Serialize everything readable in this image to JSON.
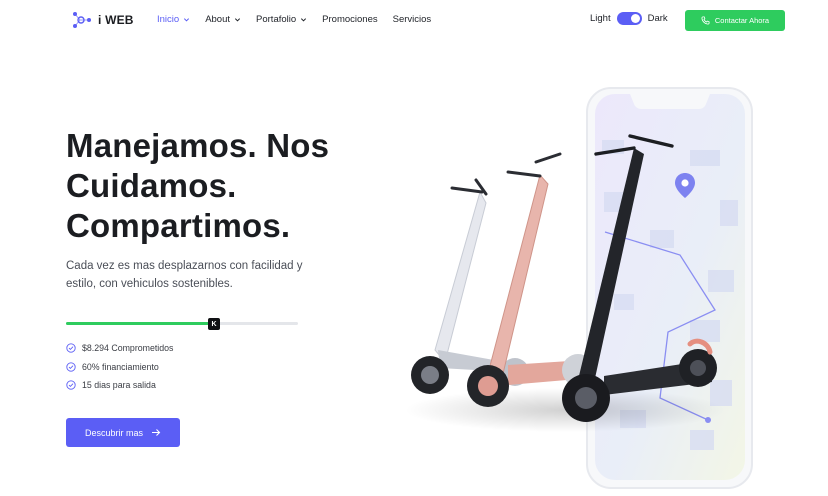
{
  "brand": {
    "name": "i WEB"
  },
  "nav": {
    "items": [
      {
        "label": "Inicio",
        "dropdown": true,
        "active": true
      },
      {
        "label": "About",
        "dropdown": true,
        "active": false
      },
      {
        "label": "Portafolio",
        "dropdown": true,
        "active": false
      },
      {
        "label": "Promociones",
        "dropdown": false,
        "active": false
      },
      {
        "label": "Servicios",
        "dropdown": false,
        "active": false
      }
    ],
    "theme": {
      "light_label": "Light",
      "dark_label": "Dark",
      "dark_enabled": true
    },
    "cta_label": "Contactar Ahora"
  },
  "hero": {
    "headline": [
      "Manejamos. Nos",
      "Cuidamos.",
      "Compartimos."
    ],
    "subtitle": "Cada vez es mas desplazarnos con facilidad y estilo, con vehiculos sostenibles.",
    "progress": {
      "fraction": 0.64,
      "marker_label": "K"
    },
    "features": [
      "$8.294 Comprometidos",
      "60% financiamiento",
      "15 dias para salida"
    ],
    "button_label": "Descubrir mas"
  },
  "colors": {
    "accent": "#5b5ef5",
    "green": "#2ecc5e",
    "text": "#1b1d21"
  },
  "icons": {
    "logo": "network-logo-icon",
    "phone": "phone-icon",
    "check": "check-circle-icon",
    "arrow": "arrow-right-icon",
    "pin": "map-pin-icon"
  }
}
